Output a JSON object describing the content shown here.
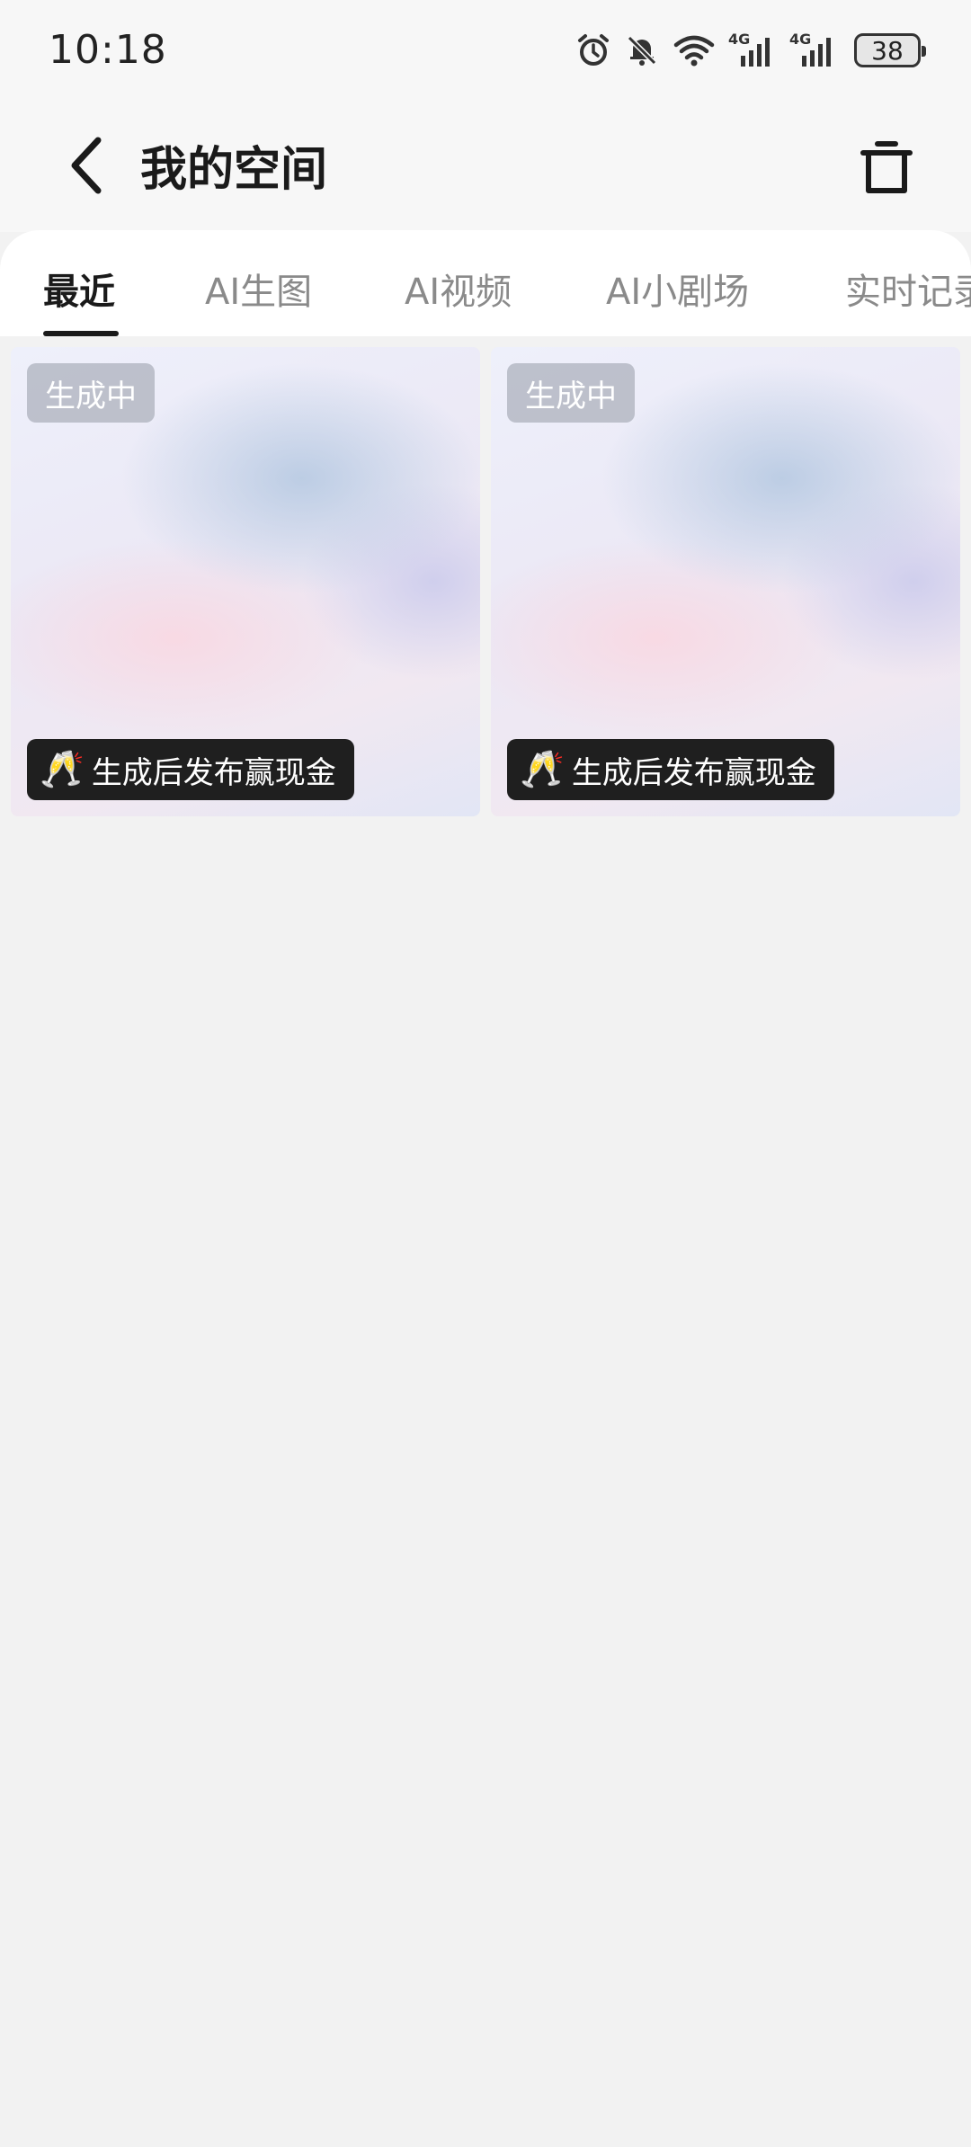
{
  "status_bar": {
    "time": "10:18",
    "battery": "38",
    "signal_1_label": "4G",
    "signal_2_label": "4G",
    "icons": [
      "alarm-icon",
      "bell-off-icon",
      "wifi-icon",
      "signal-4g-icon",
      "signal-4g-icon",
      "battery-icon"
    ]
  },
  "header": {
    "title": "我的空间",
    "back_icon": "chevron-left-icon",
    "trash_icon": "trash-icon"
  },
  "tabs": [
    {
      "label": "最近",
      "active": true
    },
    {
      "label": "AI生图",
      "active": false
    },
    {
      "label": "AI视频",
      "active": false
    },
    {
      "label": "AI小剧场",
      "active": false
    },
    {
      "label": "实时记录",
      "active": false
    }
  ],
  "cards": [
    {
      "status": "生成中",
      "promo": "生成后发布赢现金",
      "promo_icon": "🥂"
    },
    {
      "status": "生成中",
      "promo": "生成后发布赢现金",
      "promo_icon": "🥂"
    }
  ],
  "colors": {
    "background": "#f2f2f2",
    "active_tab": "#1a1a1a",
    "inactive_tab": "#8a8a8a",
    "promo_badge": "#1f1f1f"
  }
}
